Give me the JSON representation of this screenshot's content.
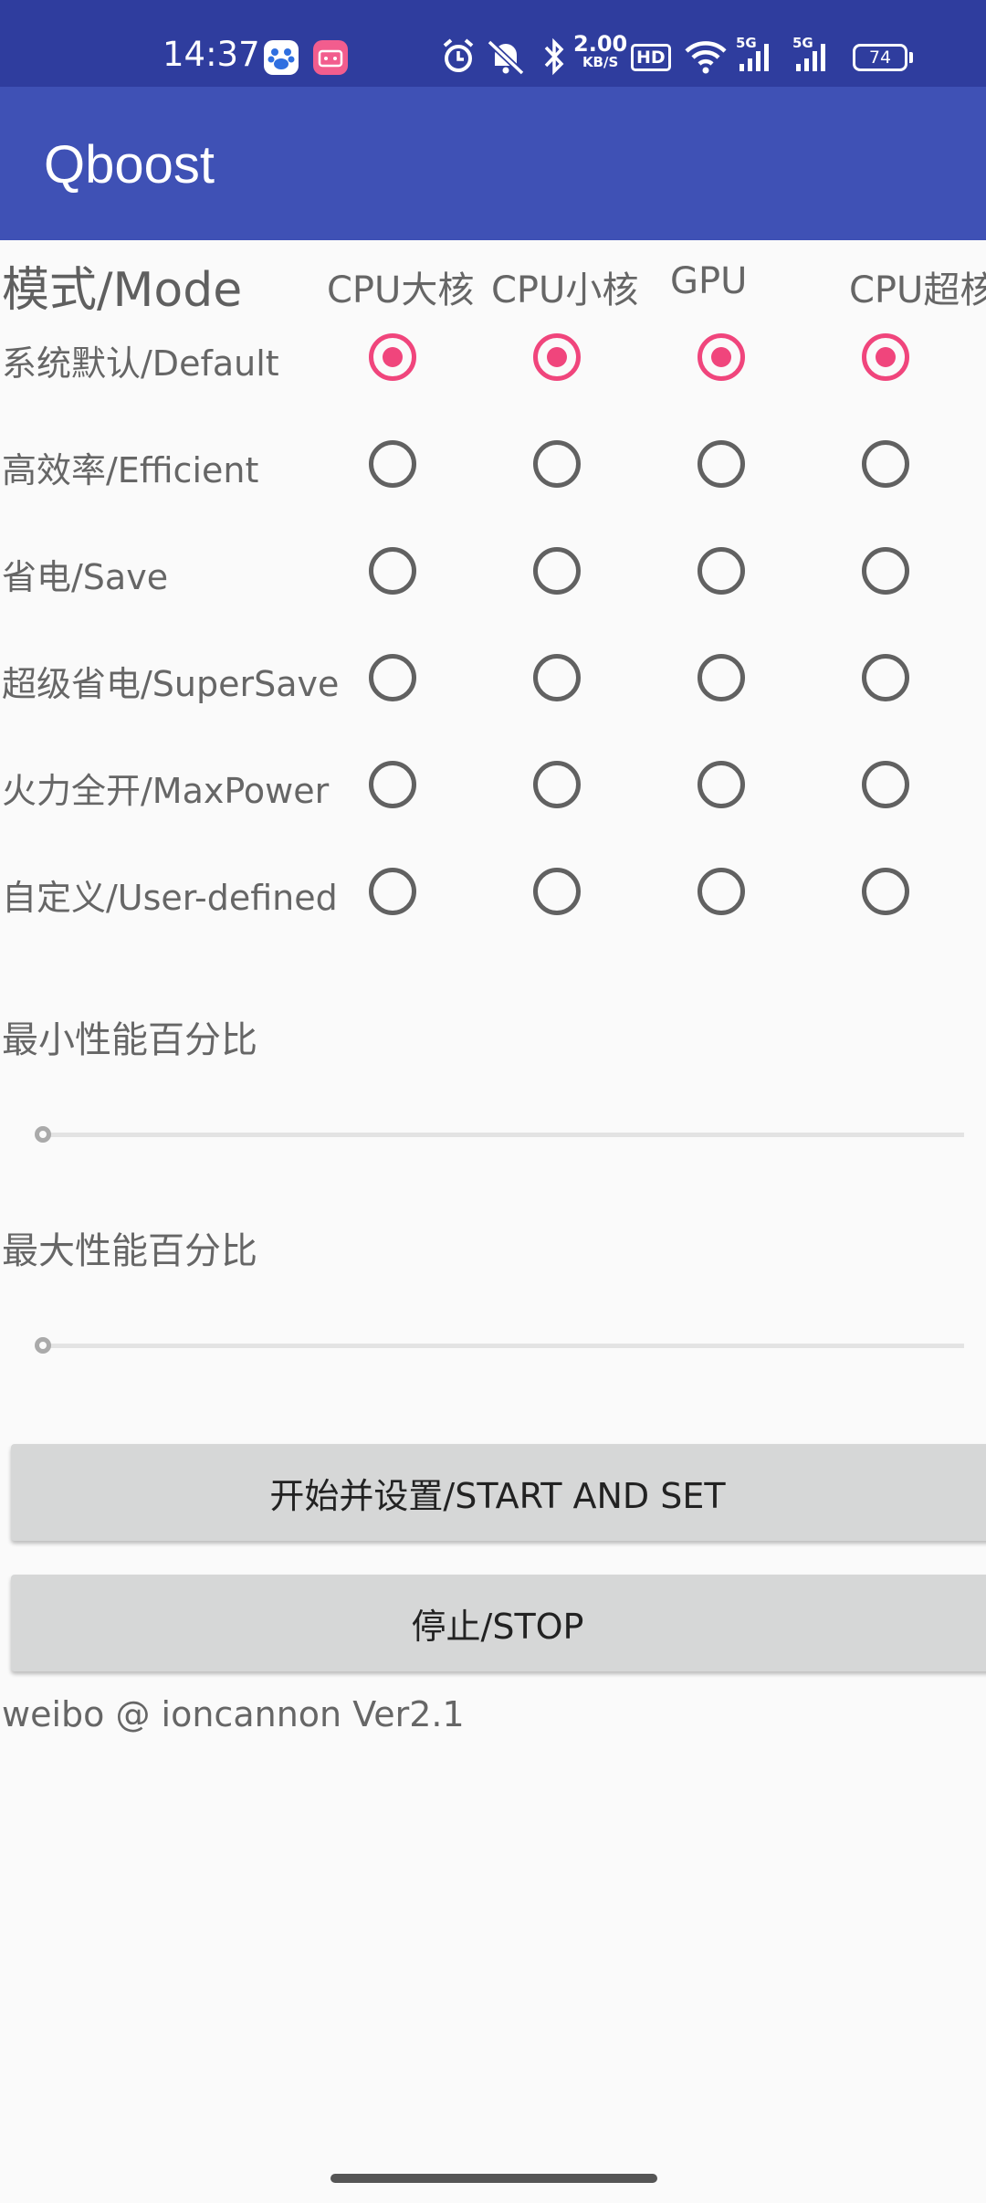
{
  "status_bar": {
    "time": "14:37",
    "speed_value": "2.00",
    "speed_unit": "KB/S",
    "hd_label": "HD",
    "signal_label_1": "5G",
    "signal_label_2": "5G",
    "battery": "74",
    "icons": [
      "baidu-app-icon",
      "bilibili-app-icon",
      "alarm-icon",
      "mute-icon",
      "bluetooth-icon",
      "hd-icon",
      "wifi-icon",
      "signal-icon",
      "signal-icon",
      "battery-icon"
    ]
  },
  "app_bar": {
    "title": "Qboost"
  },
  "grid": {
    "mode_header": "模式/Mode",
    "columns": [
      "CPU大核",
      "CPU小核",
      "GPU",
      "CPU超核"
    ],
    "rows": [
      {
        "label": "系统默认/Default",
        "selected": [
          true,
          true,
          true,
          true
        ]
      },
      {
        "label": "高效率/Efficient",
        "selected": [
          false,
          false,
          false,
          false
        ]
      },
      {
        "label": "省电/Save",
        "selected": [
          false,
          false,
          false,
          false
        ]
      },
      {
        "label": "超级省电/SuperSave",
        "selected": [
          false,
          false,
          false,
          false
        ]
      },
      {
        "label": "火力全开/MaxPower",
        "selected": [
          false,
          false,
          false,
          false
        ]
      },
      {
        "label": "自定义/User-defined",
        "selected": [
          false,
          false,
          false,
          false
        ]
      }
    ]
  },
  "sliders": {
    "min_label": "最小性能百分比",
    "min_value": 0,
    "max_label": "最大性能百分比",
    "max_value": 0
  },
  "buttons": {
    "start": "开始并设置/START AND SET",
    "stop": "停止/STOP"
  },
  "footer": "weibo @ ioncannon Ver2.1",
  "colors": {
    "status_bar": "#2f3d9e",
    "app_bar": "#3f51b5",
    "accent": "#f0457c",
    "button": "#d6d7d7"
  }
}
